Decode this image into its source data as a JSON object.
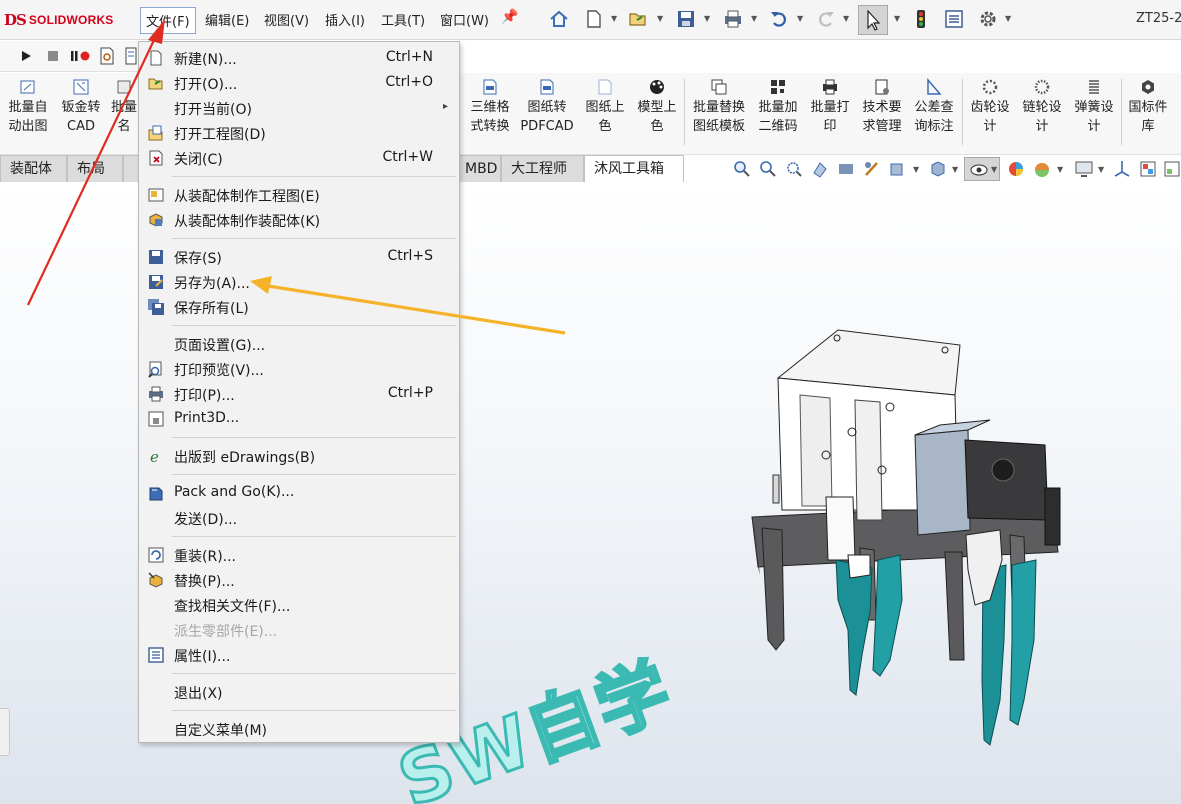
{
  "app": {
    "logo_ds": "DS",
    "logo_text": "SOLIDWORKS",
    "doc_title": "ZT25-2"
  },
  "menubar": {
    "items": [
      "文件(F)",
      "编辑(E)",
      "视图(V)",
      "插入(I)",
      "工具(T)",
      "窗口(W)"
    ],
    "icons": [
      "home-icon",
      "new-document-icon",
      "open-icon",
      "save-icon",
      "print-icon",
      "undo-icon",
      "redo-icon",
      "select-pointer-icon",
      "rebuild-traffic-light-icon",
      "file-properties-icon",
      "options-gear-icon"
    ]
  },
  "macrobar": {
    "icons": [
      "play-macro-icon",
      "stop-macro-icon",
      "record-pause-macro-icon",
      "new-macro-icon",
      "edit-macro-icon"
    ]
  },
  "command_manager": {
    "buttons": [
      {
        "line1": "批量自",
        "line2": "动出图",
        "icon": "batch-drawing-icon"
      },
      {
        "line1": "钣金转",
        "line2": "CAD",
        "icon": "sheetmetal-cad-icon"
      },
      {
        "line1": "批量",
        "line2": "名",
        "icon": "batch-rename-icon"
      },
      {
        "line1": "三维格",
        "line2": "式转换",
        "icon": "3d-format-icon"
      },
      {
        "line1": "图纸转",
        "line2": "PDFCAD",
        "icon": "drawing-pdf-icon"
      },
      {
        "line1": "图纸上",
        "line2": "色",
        "icon": "drawing-color-icon"
      },
      {
        "line1": "模型上",
        "line2": "色",
        "icon": "model-palette-icon"
      },
      {
        "line1": "批量替换",
        "line2": "图纸模板",
        "icon": "replace-template-icon"
      },
      {
        "line1": "批量加",
        "line2": "二维码",
        "icon": "qr-code-icon"
      },
      {
        "line1": "批量打",
        "line2": "印",
        "icon": "batch-print-icon"
      },
      {
        "line1": "技术要",
        "line2": "求管理",
        "icon": "tech-requirements-icon"
      },
      {
        "line1": "公差查",
        "line2": "询标注",
        "icon": "tolerance-icon"
      },
      {
        "line1": "齿轮设",
        "line2": "计",
        "icon": "gear-design-icon"
      },
      {
        "line1": "链轮设",
        "line2": "计",
        "icon": "sprocket-design-icon"
      },
      {
        "line1": "弹簧设",
        "line2": "计",
        "icon": "spring-design-icon"
      },
      {
        "line1": "国标件",
        "line2": "库",
        "icon": "standard-parts-icon"
      }
    ]
  },
  "tabs": [
    {
      "label": "装配体",
      "active": false
    },
    {
      "label": "布局",
      "active": false
    },
    {
      "label": "MBD",
      "active": false
    },
    {
      "label": "大工程师",
      "active": false
    },
    {
      "label": "沐风工具箱",
      "active": true
    }
  ],
  "headsup_icons": [
    "zoom-to-fit-icon",
    "zoom-area-icon",
    "previous-view-icon",
    "section-view-icon",
    "dynamic-annotation-icon",
    "view-settings-icon",
    "display-style-icon",
    "view-orientation-icon",
    "hide-show-icon",
    "edit-appearance-icon",
    "apply-scene-icon",
    "monitor-icon",
    "coordinate-icon",
    "view-palette-icon"
  ],
  "file_menu": {
    "items": [
      {
        "label": "新建(N)...",
        "shortcut": "Ctrl+N",
        "icon": "new-document-icon"
      },
      {
        "label": "打开(O)...",
        "shortcut": "Ctrl+O",
        "icon": "open-folder-icon"
      },
      {
        "label": "打开当前(O)",
        "shortcut": "",
        "icon": "",
        "submenu": true
      },
      {
        "label": "打开工程图(D)",
        "shortcut": "",
        "icon": "open-drawing-icon"
      },
      {
        "label": "关闭(C)",
        "shortcut": "Ctrl+W",
        "icon": "close-document-icon"
      },
      {
        "label": "从装配体制作工程图(E)",
        "shortcut": "",
        "icon": "make-drawing-icon"
      },
      {
        "label": "从装配体制作装配体(K)",
        "shortcut": "",
        "icon": "make-assembly-icon"
      },
      {
        "label": "保存(S)",
        "shortcut": "Ctrl+S",
        "icon": "save-icon"
      },
      {
        "label": "另存为(A)...",
        "shortcut": "",
        "icon": "save-as-icon"
      },
      {
        "label": "保存所有(L)",
        "shortcut": "",
        "icon": "save-all-icon"
      },
      {
        "label": "页面设置(G)...",
        "shortcut": "",
        "icon": ""
      },
      {
        "label": "打印预览(V)...",
        "shortcut": "",
        "icon": "print-preview-icon"
      },
      {
        "label": "打印(P)...",
        "shortcut": "Ctrl+P",
        "icon": "print-icon"
      },
      {
        "label": "Print3D...",
        "shortcut": "",
        "icon": "print3d-icon"
      },
      {
        "label": "出版到 eDrawings(B)",
        "shortcut": "",
        "icon": "edrawings-icon"
      },
      {
        "label": "Pack and Go(K)...",
        "shortcut": "",
        "icon": "pack-and-go-icon"
      },
      {
        "label": "发送(D)...",
        "shortcut": "",
        "icon": ""
      },
      {
        "label": "重装(R)...",
        "shortcut": "",
        "icon": "reload-icon"
      },
      {
        "label": "替换(P)...",
        "shortcut": "",
        "icon": "replace-icon"
      },
      {
        "label": "查找相关文件(F)...",
        "shortcut": "",
        "icon": ""
      },
      {
        "label": "派生零部件(E)...",
        "shortcut": "",
        "icon": "",
        "disabled": true
      },
      {
        "label": "属性(I)...",
        "shortcut": "",
        "icon": "properties-icon"
      },
      {
        "label": "退出(X)",
        "shortcut": "",
        "icon": ""
      },
      {
        "label": "自定义菜单(M)",
        "shortcut": "",
        "icon": ""
      }
    ]
  },
  "watermark": {
    "text": "SW自学"
  },
  "colors": {
    "accent_red": "#e02b20",
    "highlight_arrow": "#f5b32a",
    "watermark_fill": "#b9f0ee",
    "watermark_stroke": "#3bb9b3",
    "gripper_teal": "#1a8f96"
  }
}
